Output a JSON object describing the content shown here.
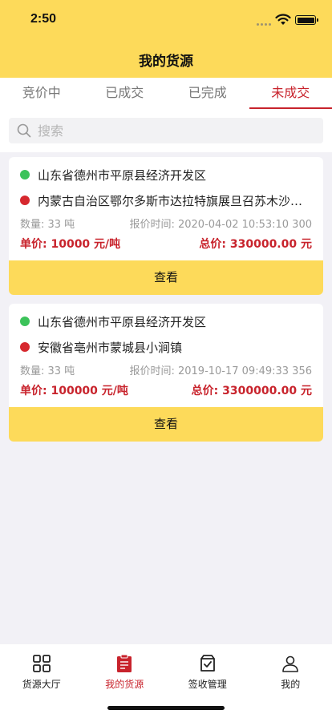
{
  "status_bar": {
    "time": "2:50"
  },
  "nav": {
    "title": "我的货源"
  },
  "tabs": [
    {
      "label": "竞价中",
      "active": false
    },
    {
      "label": "已成交",
      "active": false
    },
    {
      "label": "已完成",
      "active": false
    },
    {
      "label": "未成交",
      "active": true
    }
  ],
  "search": {
    "placeholder": "搜索",
    "value": ""
  },
  "cards": [
    {
      "origin": "山东省德州市平原县经济开发区",
      "destination": "内蒙古自治区鄂尔多斯市达拉特旗展旦召苏木沙…",
      "quantity": "数量: 33 吨",
      "quote_time": "报价时间: 2020-04-02 10:53:10 300",
      "unit_price": "单价: 10000 元/吨",
      "total_price": "总价: 330000.00 元",
      "button": "查看"
    },
    {
      "origin": "山东省德州市平原县经济开发区",
      "destination": "安徽省亳州市蒙城县小涧镇",
      "quantity": "数量: 33 吨",
      "quote_time": "报价时间: 2019-10-17 09:49:33 356",
      "unit_price": "单价: 100000 元/吨",
      "total_price": "总价: 3300000.00 元",
      "button": "查看"
    }
  ],
  "tab_bar": [
    {
      "label": "货源大厅",
      "icon": "grid-icon",
      "active": false
    },
    {
      "label": "我的货源",
      "icon": "clipboard-icon",
      "active": true
    },
    {
      "label": "签收管理",
      "icon": "checked-box-icon",
      "active": false
    },
    {
      "label": "我的",
      "icon": "user-icon",
      "active": false
    }
  ],
  "colors": {
    "accent_yellow": "#fdda5a",
    "accent_red": "#c8232c",
    "dot_green": "#3cc35a",
    "dot_red": "#d6282e"
  }
}
